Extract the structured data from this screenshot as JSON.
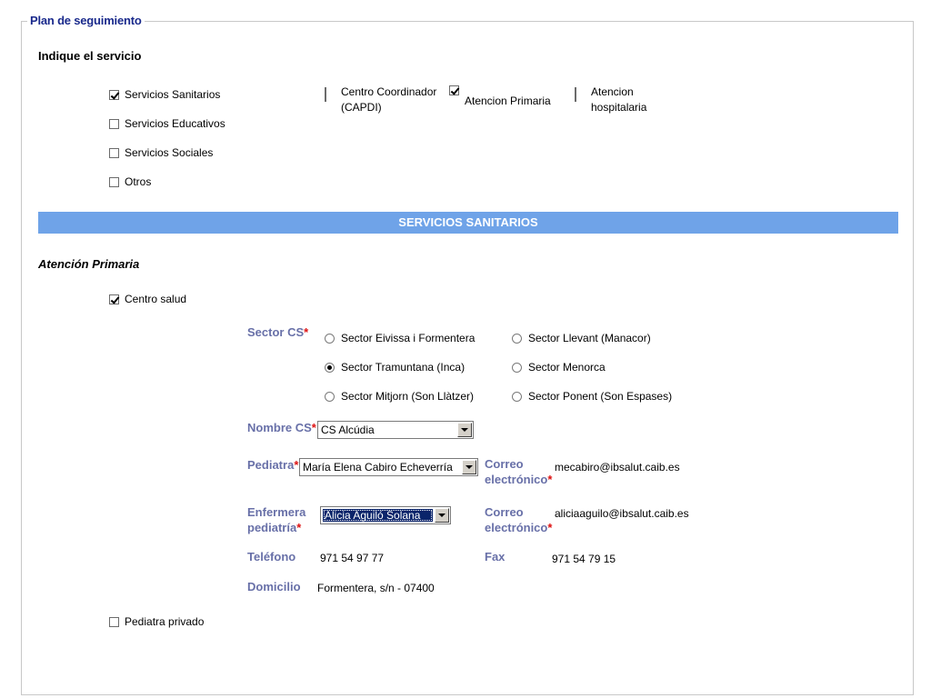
{
  "fieldset": {
    "legend": "Plan de seguimiento"
  },
  "servicio": {
    "heading": "Indique el servicio",
    "options": [
      {
        "label": "Servicios Sanitarios",
        "checked": true
      },
      {
        "label": "Servicios Educativos",
        "checked": false
      },
      {
        "label": "Servicios Sociales",
        "checked": false
      },
      {
        "label": "Otros",
        "checked": false
      }
    ],
    "sub_options": [
      {
        "label_line1": "Centro Coordinador",
        "label_line2": "(CAPDI)",
        "checked": false
      },
      {
        "label_line1": "Atencion Primaria",
        "label_line2": "",
        "checked": true
      },
      {
        "label_line1": "Atencion",
        "label_line2": "hospitalaria",
        "checked": false
      }
    ]
  },
  "sanitarios": {
    "bar_title": "SERVICIOS SANITARIOS",
    "subheading": "Atención Primaria",
    "centro_salud": {
      "label": "Centro salud",
      "checked": true
    },
    "sector": {
      "label": "Sector CS",
      "required": "*",
      "options": [
        {
          "label": "Sector Eivissa i Formentera",
          "checked": false
        },
        {
          "label": "Sector Llevant (Manacor)",
          "checked": false
        },
        {
          "label": "Sector Tramuntana (Inca)",
          "checked": true
        },
        {
          "label": "Sector Menorca",
          "checked": false
        },
        {
          "label": "Sector Mitjorn (Son Llàtzer)",
          "checked": false
        },
        {
          "label": "Sector Ponent (Son Espases)",
          "checked": false
        }
      ]
    },
    "nombre_cs": {
      "label": "Nombre CS",
      "required": "*",
      "value": "CS Alcúdia"
    },
    "pediatra": {
      "label": "Pediatra",
      "required": "*",
      "value": "María Elena Cabiro Echeverría",
      "email_label_1": "Correo",
      "email_label_2": "electrónico",
      "email_required": "*",
      "email": "mecabiro@ibsalut.caib.es"
    },
    "enfermera": {
      "label_1": "Enfermera",
      "label_2": "pediatría",
      "required": "*",
      "value": "Alicia Aguiló Solana",
      "email_label_1": "Correo",
      "email_label_2": "electrónico",
      "email_required": "*",
      "email": "aliciaaguilo@ibsalut.caib.es"
    },
    "telefono": {
      "label": "Teléfono",
      "value": "971 54 97 77"
    },
    "fax": {
      "label": "Fax",
      "value": "971 54 79 15"
    },
    "domicilio": {
      "label": "Domicilio",
      "value": "Formentera, s/n - 07400"
    },
    "pediatra_privado": {
      "label": "Pediatra privado",
      "checked": false
    }
  },
  "colors": {
    "bar": "#6fa3e8",
    "legend": "#1a2a8c",
    "field_label": "#6870a8",
    "required": "#dd1111"
  }
}
